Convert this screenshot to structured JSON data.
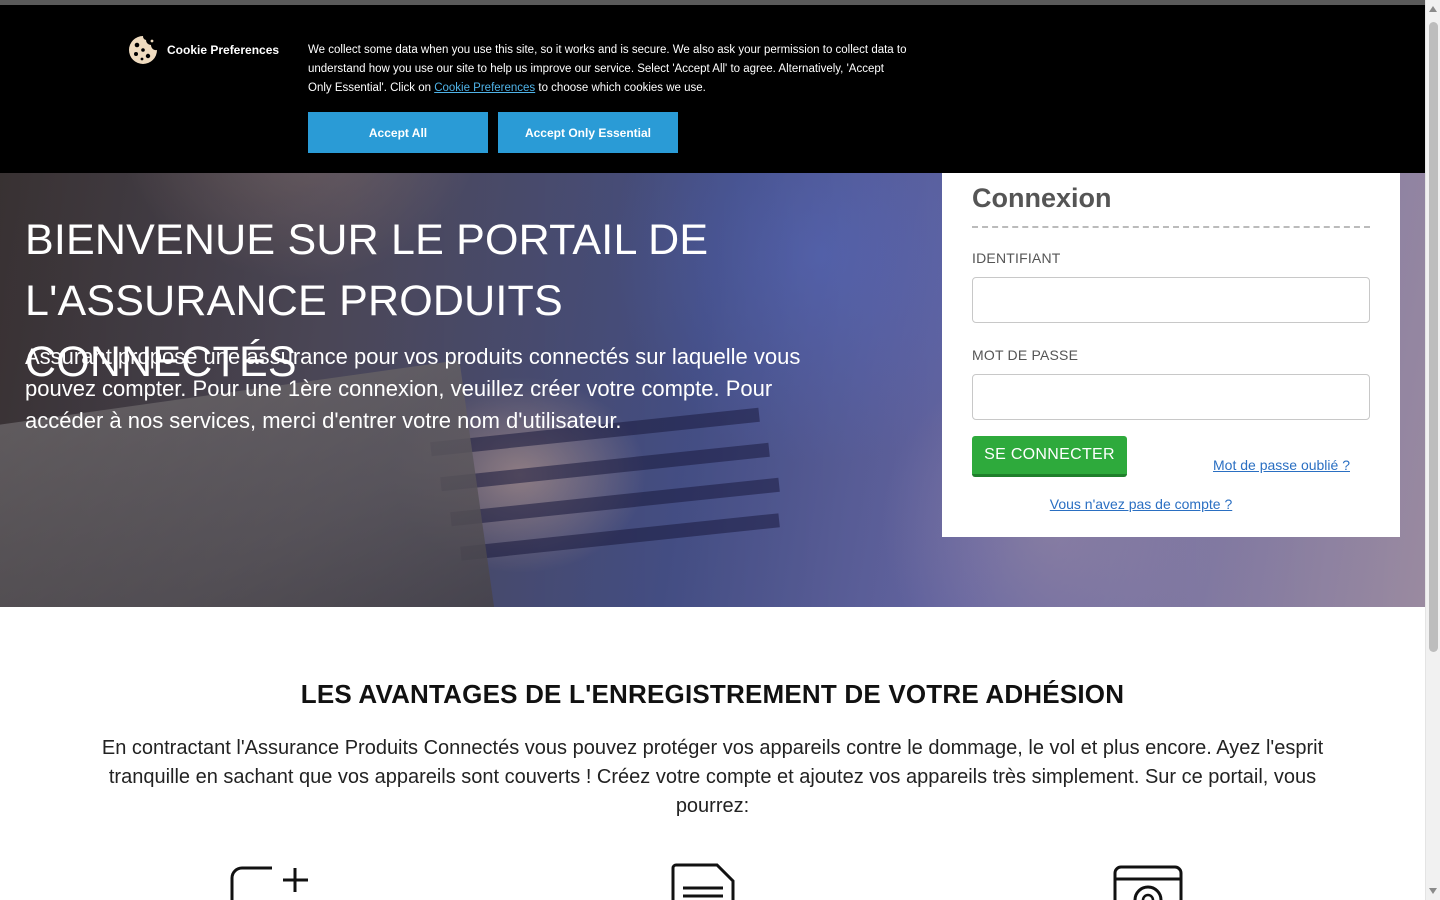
{
  "cookie_banner": {
    "brand": "Cookie Preferences",
    "text_before_link": "We collect some data when you use this site, so it works and is secure. We also ask your permission to collect data to understand how you use our site to help us improve our service. Select 'Accept All' to agree. Alternatively, 'Accept Only Essential'. Click on ",
    "link_text": "Cookie Preferences",
    "text_after_link": " to choose which cookies we use.",
    "accept_all": "Accept All",
    "accept_essential": "Accept Only Essential"
  },
  "hero": {
    "title": "BIENVENUE SUR LE PORTAIL DE L'ASSURANCE PRODUITS CONNECTÉS",
    "text": "Assurant propose une assurance pour vos produits connectés sur laquelle vous pouvez compter. Pour une 1ère connexion, veuillez créer votre compte. Pour accéder à nos services, merci d'entrer votre nom d'utilisateur."
  },
  "login": {
    "title": "Connexion",
    "username_label": "IDENTIFIANT",
    "username_value": "",
    "password_label": "MOT DE PASSE",
    "password_value": "",
    "submit": "SE CONNECTER",
    "forgot_link": "Mot de passe oublié ?",
    "no_account_link": "Vous n'avez pas de compte ?"
  },
  "benefits": {
    "title": "LES AVANTAGES DE L'ENREGISTREMENT DE VOTRE ADHÉSION",
    "text": "En contractant l'Assurance Produits Connectés vous pouvez protéger vos appareils contre le dommage, le vol et plus encore. Ayez l'esprit tranquille en sachant que vos appareils sont couverts ! Créez votre compte et ajoutez vos appareils très simplement.  Sur ce portail, vous pourrez:",
    "icons": [
      "add-device-icon",
      "document-icon",
      "washing-machine-icon"
    ]
  },
  "colors": {
    "banner_bg": "#000000",
    "banner_button": "#2a9bd6",
    "connect_button": "#2eaa3c",
    "link": "#2a6fc2"
  }
}
